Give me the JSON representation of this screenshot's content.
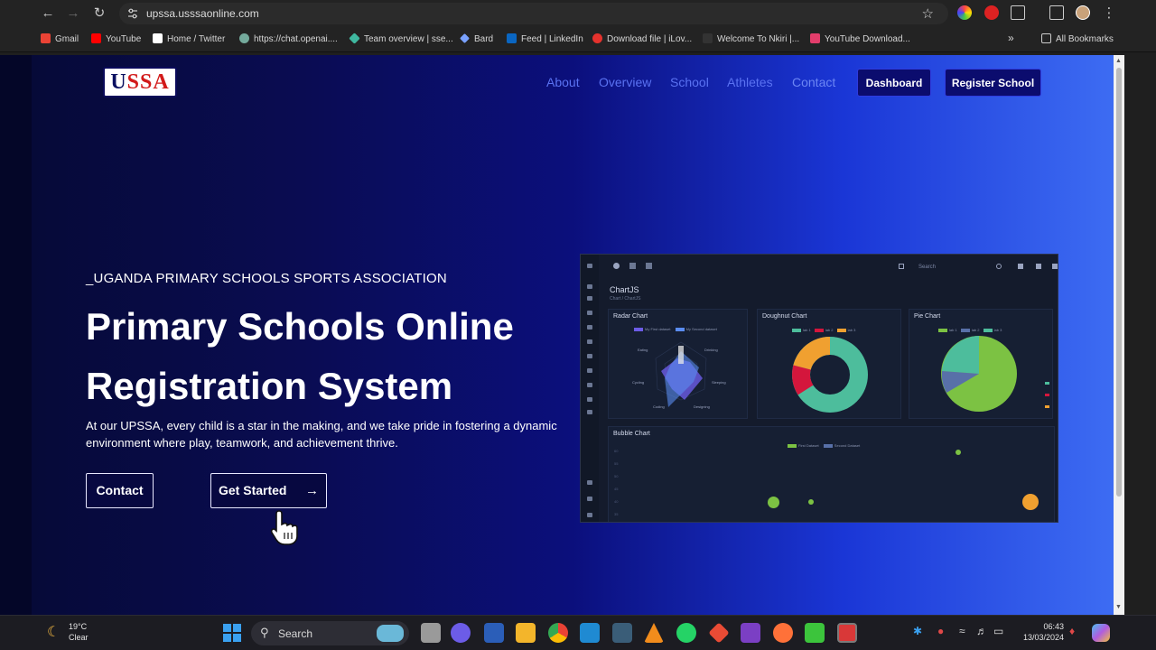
{
  "browser": {
    "url": "upssa.usssaonline.com",
    "bookmarks": [
      {
        "label": "Gmail",
        "color": "#ea4335"
      },
      {
        "label": "YouTube",
        "color": "#ff0000"
      },
      {
        "label": "Home / Twitter",
        "color": "#ffffff"
      },
      {
        "label": "https://chat.openai....",
        "color": "#74aa9c"
      },
      {
        "label": "Team overview | sse...",
        "color": "#3fb8a0"
      },
      {
        "label": "Bard",
        "color": "#7aa2ff"
      },
      {
        "label": "Feed | LinkedIn",
        "color": "#0a66c2"
      },
      {
        "label": "Download file | iLov...",
        "color": "#e5322d"
      },
      {
        "label": "Welcome To Nkiri |...",
        "color": "#333333"
      },
      {
        "label": "YouTube Download...",
        "color": "#e23d6b"
      }
    ],
    "all_bookmarks": "All Bookmarks"
  },
  "site": {
    "logo": {
      "part1": "U",
      "part2": "SSA"
    },
    "nav": [
      "About",
      "Overview",
      "School",
      "Athletes",
      "Contact"
    ],
    "dashboard_button": "Dashboard",
    "register_button": "Register School"
  },
  "hero": {
    "eyebrow": "_UGANDA PRIMARY SCHOOLS SPORTS ASSOCIATION",
    "title_line1": "Primary Schools Online",
    "title_line2": "Registration System",
    "description": "At our UPSSA, every child is a star in the making, and we take pride in fostering a dynamic environment where play, teamwork, and achievement thrive.",
    "contact_button": "Contact",
    "get_started_button": "Get Started"
  },
  "preview": {
    "search_placeholder": "Search",
    "title": "ChartJS",
    "breadcrumb": "Chart / ChartJS",
    "radar_title": "Radar Chart",
    "radar_legend": [
      "My First dataset",
      "My Second dataset"
    ],
    "radar_labels": [
      "Eating",
      "Drinking",
      "Sleeping",
      "Designing",
      "Coding",
      "Cycling",
      "Running"
    ],
    "doughnut_title": "Doughnut Chart",
    "doughnut_legend": [
      "lab 1",
      "lab 2",
      "lab 3"
    ],
    "pie_title": "Pie Chart",
    "pie_legend": [
      "lab 1",
      "lab 2",
      "lab 3"
    ],
    "bubble_title": "Bubble Chart",
    "bubble_legend": [
      "First Dataset",
      "Second Dataset"
    ],
    "bubble_yticks": [
      "60",
      "55",
      "50",
      "45",
      "40",
      "35",
      "30"
    ],
    "colors": {
      "teal": "#4dbd9c",
      "orange": "#f0a030",
      "crimson": "#d4163c",
      "green": "#7cc243",
      "slate": "#5870a8",
      "purple": "#6c5ce7"
    }
  },
  "taskbar": {
    "temperature": "19°C",
    "condition": "Clear",
    "search": "Search",
    "time": "06:43",
    "date": "13/03/2024"
  }
}
